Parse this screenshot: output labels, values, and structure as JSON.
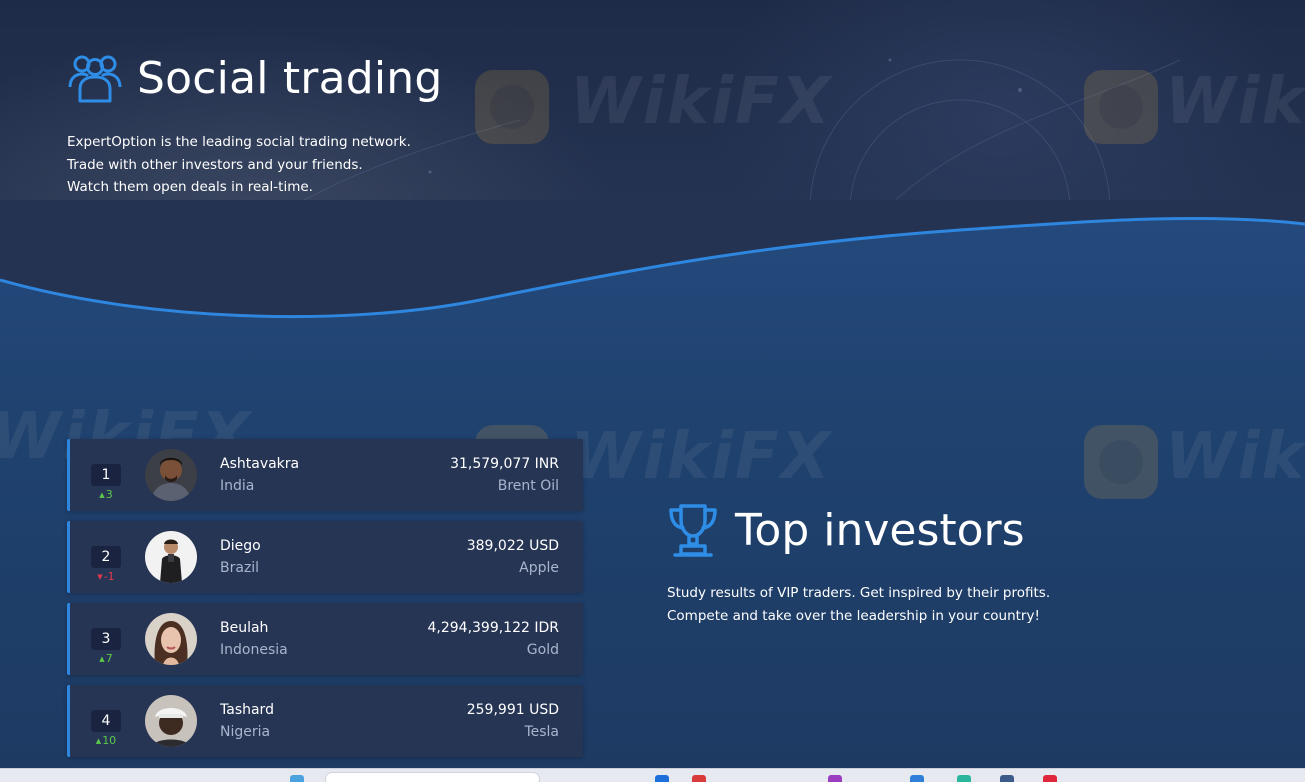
{
  "hero": {
    "title": "Social trading",
    "icon": "users-group-icon",
    "description": [
      "ExpertOption is the leading social trading network.",
      "Trade with other investors and your friends.",
      "Watch them open deals in real-time."
    ]
  },
  "leaderboard": [
    {
      "rank": "1",
      "change": "3",
      "direction": "up",
      "name": "Ashtavakra",
      "country": "India",
      "amount": "31,579,077 INR",
      "asset": "Brent Oil"
    },
    {
      "rank": "2",
      "change": "-1",
      "direction": "down",
      "name": "Diego",
      "country": "Brazil",
      "amount": "389,022 USD",
      "asset": "Apple"
    },
    {
      "rank": "3",
      "change": "7",
      "direction": "up",
      "name": "Beulah",
      "country": "Indonesia",
      "amount": "4,294,399,122 IDR",
      "asset": "Gold"
    },
    {
      "rank": "4",
      "change": "10",
      "direction": "up",
      "name": "Tashard",
      "country": "Nigeria",
      "amount": "259,991 USD",
      "asset": "Tesla"
    }
  ],
  "top_investors": {
    "title": "Top investors",
    "icon": "trophy-icon",
    "description": [
      "Study results of VIP traders. Get inspired by their profits.",
      "Compete and take over the leadership in your country!"
    ]
  },
  "watermark": {
    "text": "WikiFX"
  },
  "colors": {
    "accent": "#2e86de",
    "card": "#273555",
    "up": "#5cc84a",
    "down": "#e2374b",
    "muted_text": "#a8b5cc"
  }
}
